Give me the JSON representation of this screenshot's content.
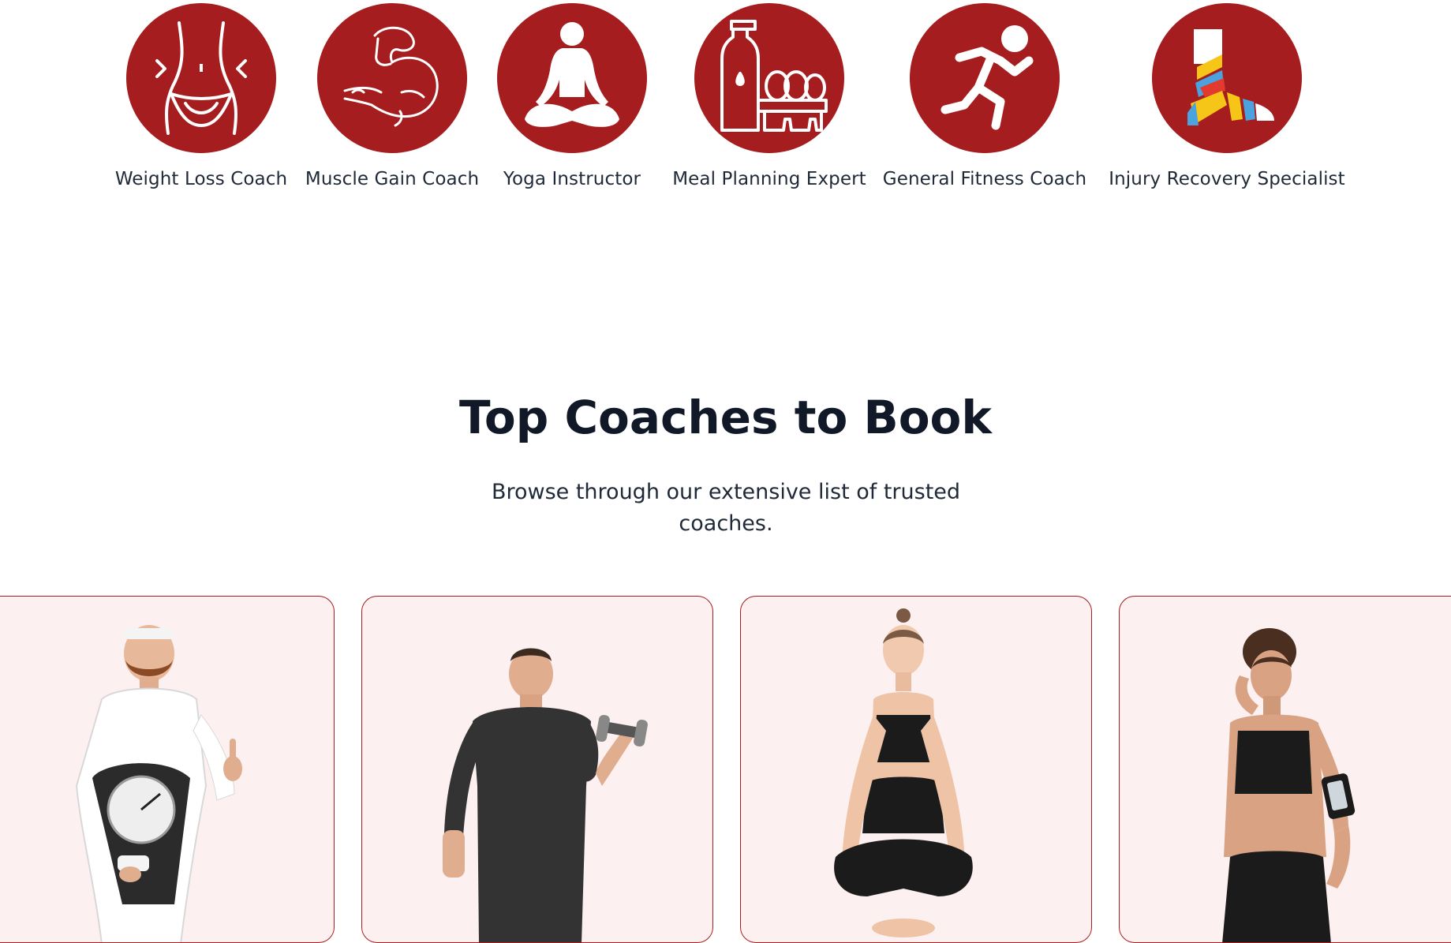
{
  "specialties": [
    {
      "label": "Weight Loss Coach",
      "icon": "waist-icon"
    },
    {
      "label": "Muscle Gain Coach",
      "icon": "flexed-bicep-icon"
    },
    {
      "label": "Yoga Instructor",
      "icon": "meditation-icon"
    },
    {
      "label": "Meal Planning Expert",
      "icon": "milk-eggs-icon"
    },
    {
      "label": "General Fitness Coach",
      "icon": "running-person-icon"
    },
    {
      "label": "Injury Recovery Specialist",
      "icon": "bandaged-foot-icon"
    }
  ],
  "section": {
    "title": "Top Coaches to Book",
    "subtitle": "Browse through our extensive list of trusted coaches."
  },
  "coaches": [
    {
      "image": "coach-with-bathroom-scale-photo"
    },
    {
      "image": "coach-with-dumbbell-photo"
    },
    {
      "image": "coach-meditating-photo"
    },
    {
      "image": "coach-with-armband-photo"
    }
  ],
  "colors": {
    "accent": "#a51d1f",
    "card_background": "#fdf0f1",
    "heading": "#111827",
    "text": "#1f2937"
  }
}
